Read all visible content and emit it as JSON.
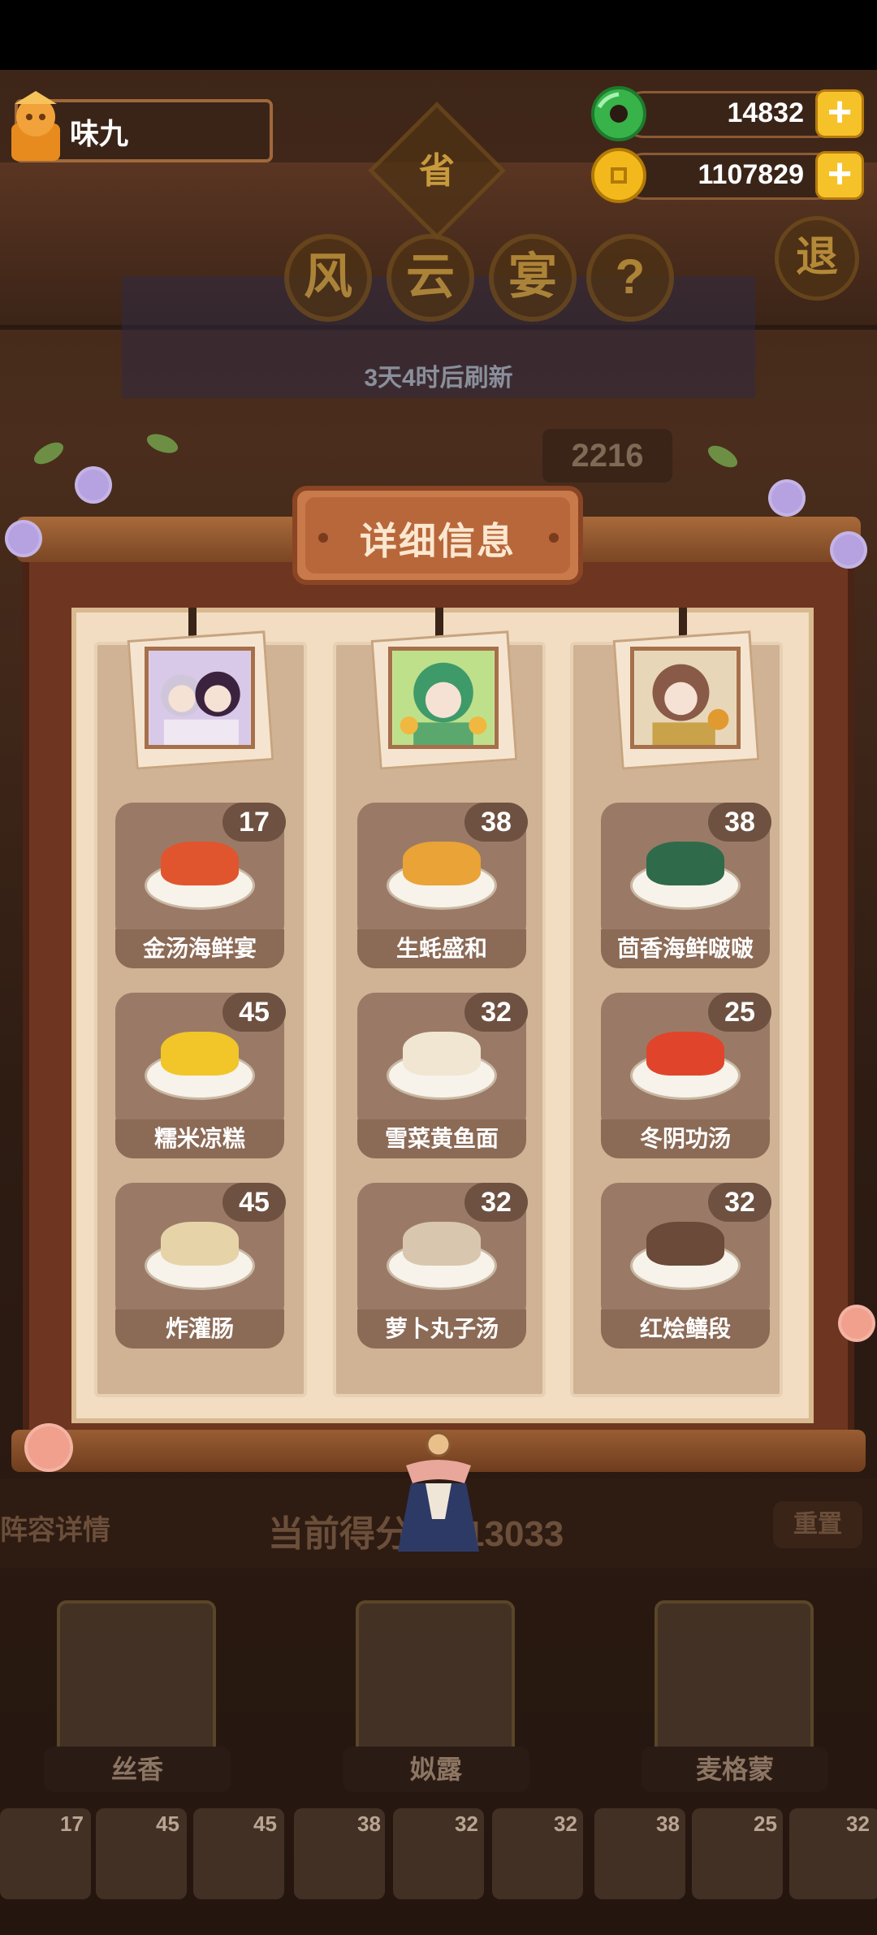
{
  "player": {
    "name": "味九"
  },
  "currencies": [
    {
      "icon": "jade-coin-icon",
      "value": "14832",
      "color": "#37b34a"
    },
    {
      "icon": "gold-coin-icon",
      "value": "1107829",
      "color": "#f3b91c"
    }
  ],
  "banner": {
    "province": "省",
    "title_chars": [
      "风",
      "云",
      "宴"
    ],
    "help_glyph": "?",
    "exit": "退",
    "refresh": "3天4时后刷新",
    "score_peek": "2216"
  },
  "modal": {
    "title": "详细信息",
    "columns": [
      {
        "portrait": "character-pair-portrait",
        "dishes": [
          {
            "name": "金汤海鲜宴",
            "count": "17",
            "color": "#e0552d"
          },
          {
            "name": "糯米凉糕",
            "count": "45",
            "color": "#f2c529"
          },
          {
            "name": "炸灌肠",
            "count": "45",
            "color": "#e7d3a8"
          }
        ]
      },
      {
        "portrait": "green-hair-character-portrait",
        "dishes": [
          {
            "name": "生蚝盛和",
            "count": "38",
            "color": "#e9a336"
          },
          {
            "name": "雪菜黄鱼面",
            "count": "32",
            "color": "#f0e6d2"
          },
          {
            "name": "萝卜丸子汤",
            "count": "32",
            "color": "#d8c7ae"
          }
        ]
      },
      {
        "portrait": "brown-hair-character-portrait",
        "dishes": [
          {
            "name": "茴香海鲜啵啵",
            "count": "38",
            "color": "#2f6b4a"
          },
          {
            "name": "冬阴功汤",
            "count": "25",
            "color": "#e0452b"
          },
          {
            "name": "红烩鳝段",
            "count": "32",
            "color": "#6b4a3a"
          }
        ]
      }
    ]
  },
  "bottom": {
    "detail_label": "阵容详情",
    "score_text": "当前得分：113033",
    "reset": "重置",
    "characters": [
      "丝香",
      "姒露",
      "麦格蒙"
    ],
    "dish_counts": [
      "17",
      "45",
      "45",
      "38",
      "32",
      "32",
      "38",
      "25",
      "32"
    ]
  }
}
